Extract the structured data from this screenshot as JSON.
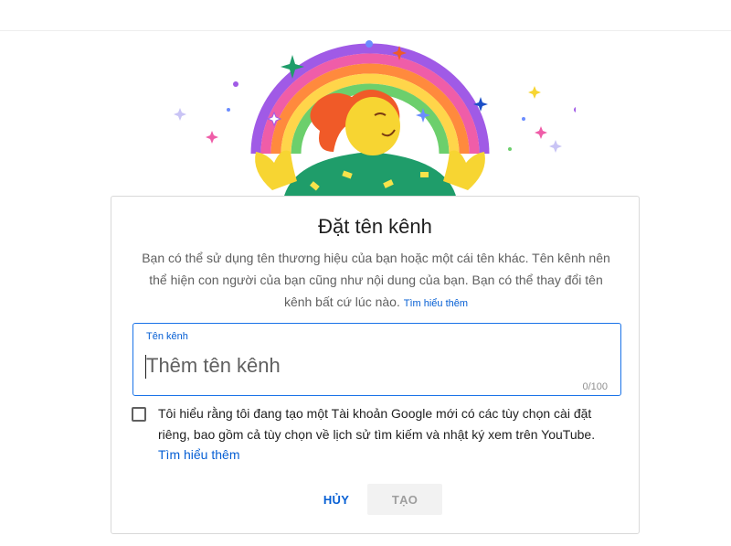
{
  "dialog": {
    "title": "Đặt tên kênh",
    "description": "Bạn có thể sử dụng tên thương hiệu của bạn hoặc một cái tên khác. Tên kênh nên thể hiện con người của bạn cũng như nội dung của bạn. Bạn có thể thay đổi tên kênh bất cứ lúc nào.",
    "learn_more": "Tìm hiểu thêm",
    "field": {
      "label": "Tên kênh",
      "placeholder": "Thêm tên kênh",
      "value": "",
      "counter": "0/100"
    },
    "consent": {
      "text": "Tôi hiểu rằng tôi đang tạo một Tài khoản Google mới có các tùy chọn cài đặt riêng, bao gồm cả tùy chọn về lịch sử tìm kiếm và nhật ký xem trên YouTube.",
      "link": "Tìm hiểu thêm",
      "checked": false
    },
    "buttons": {
      "cancel": "HỦY",
      "create": "TẠO"
    }
  },
  "colors": {
    "accent": "#065fd4",
    "field_border": "#1a73e8",
    "disabled_bg": "#f2f2f2",
    "disabled_text": "#9e9e9e"
  }
}
